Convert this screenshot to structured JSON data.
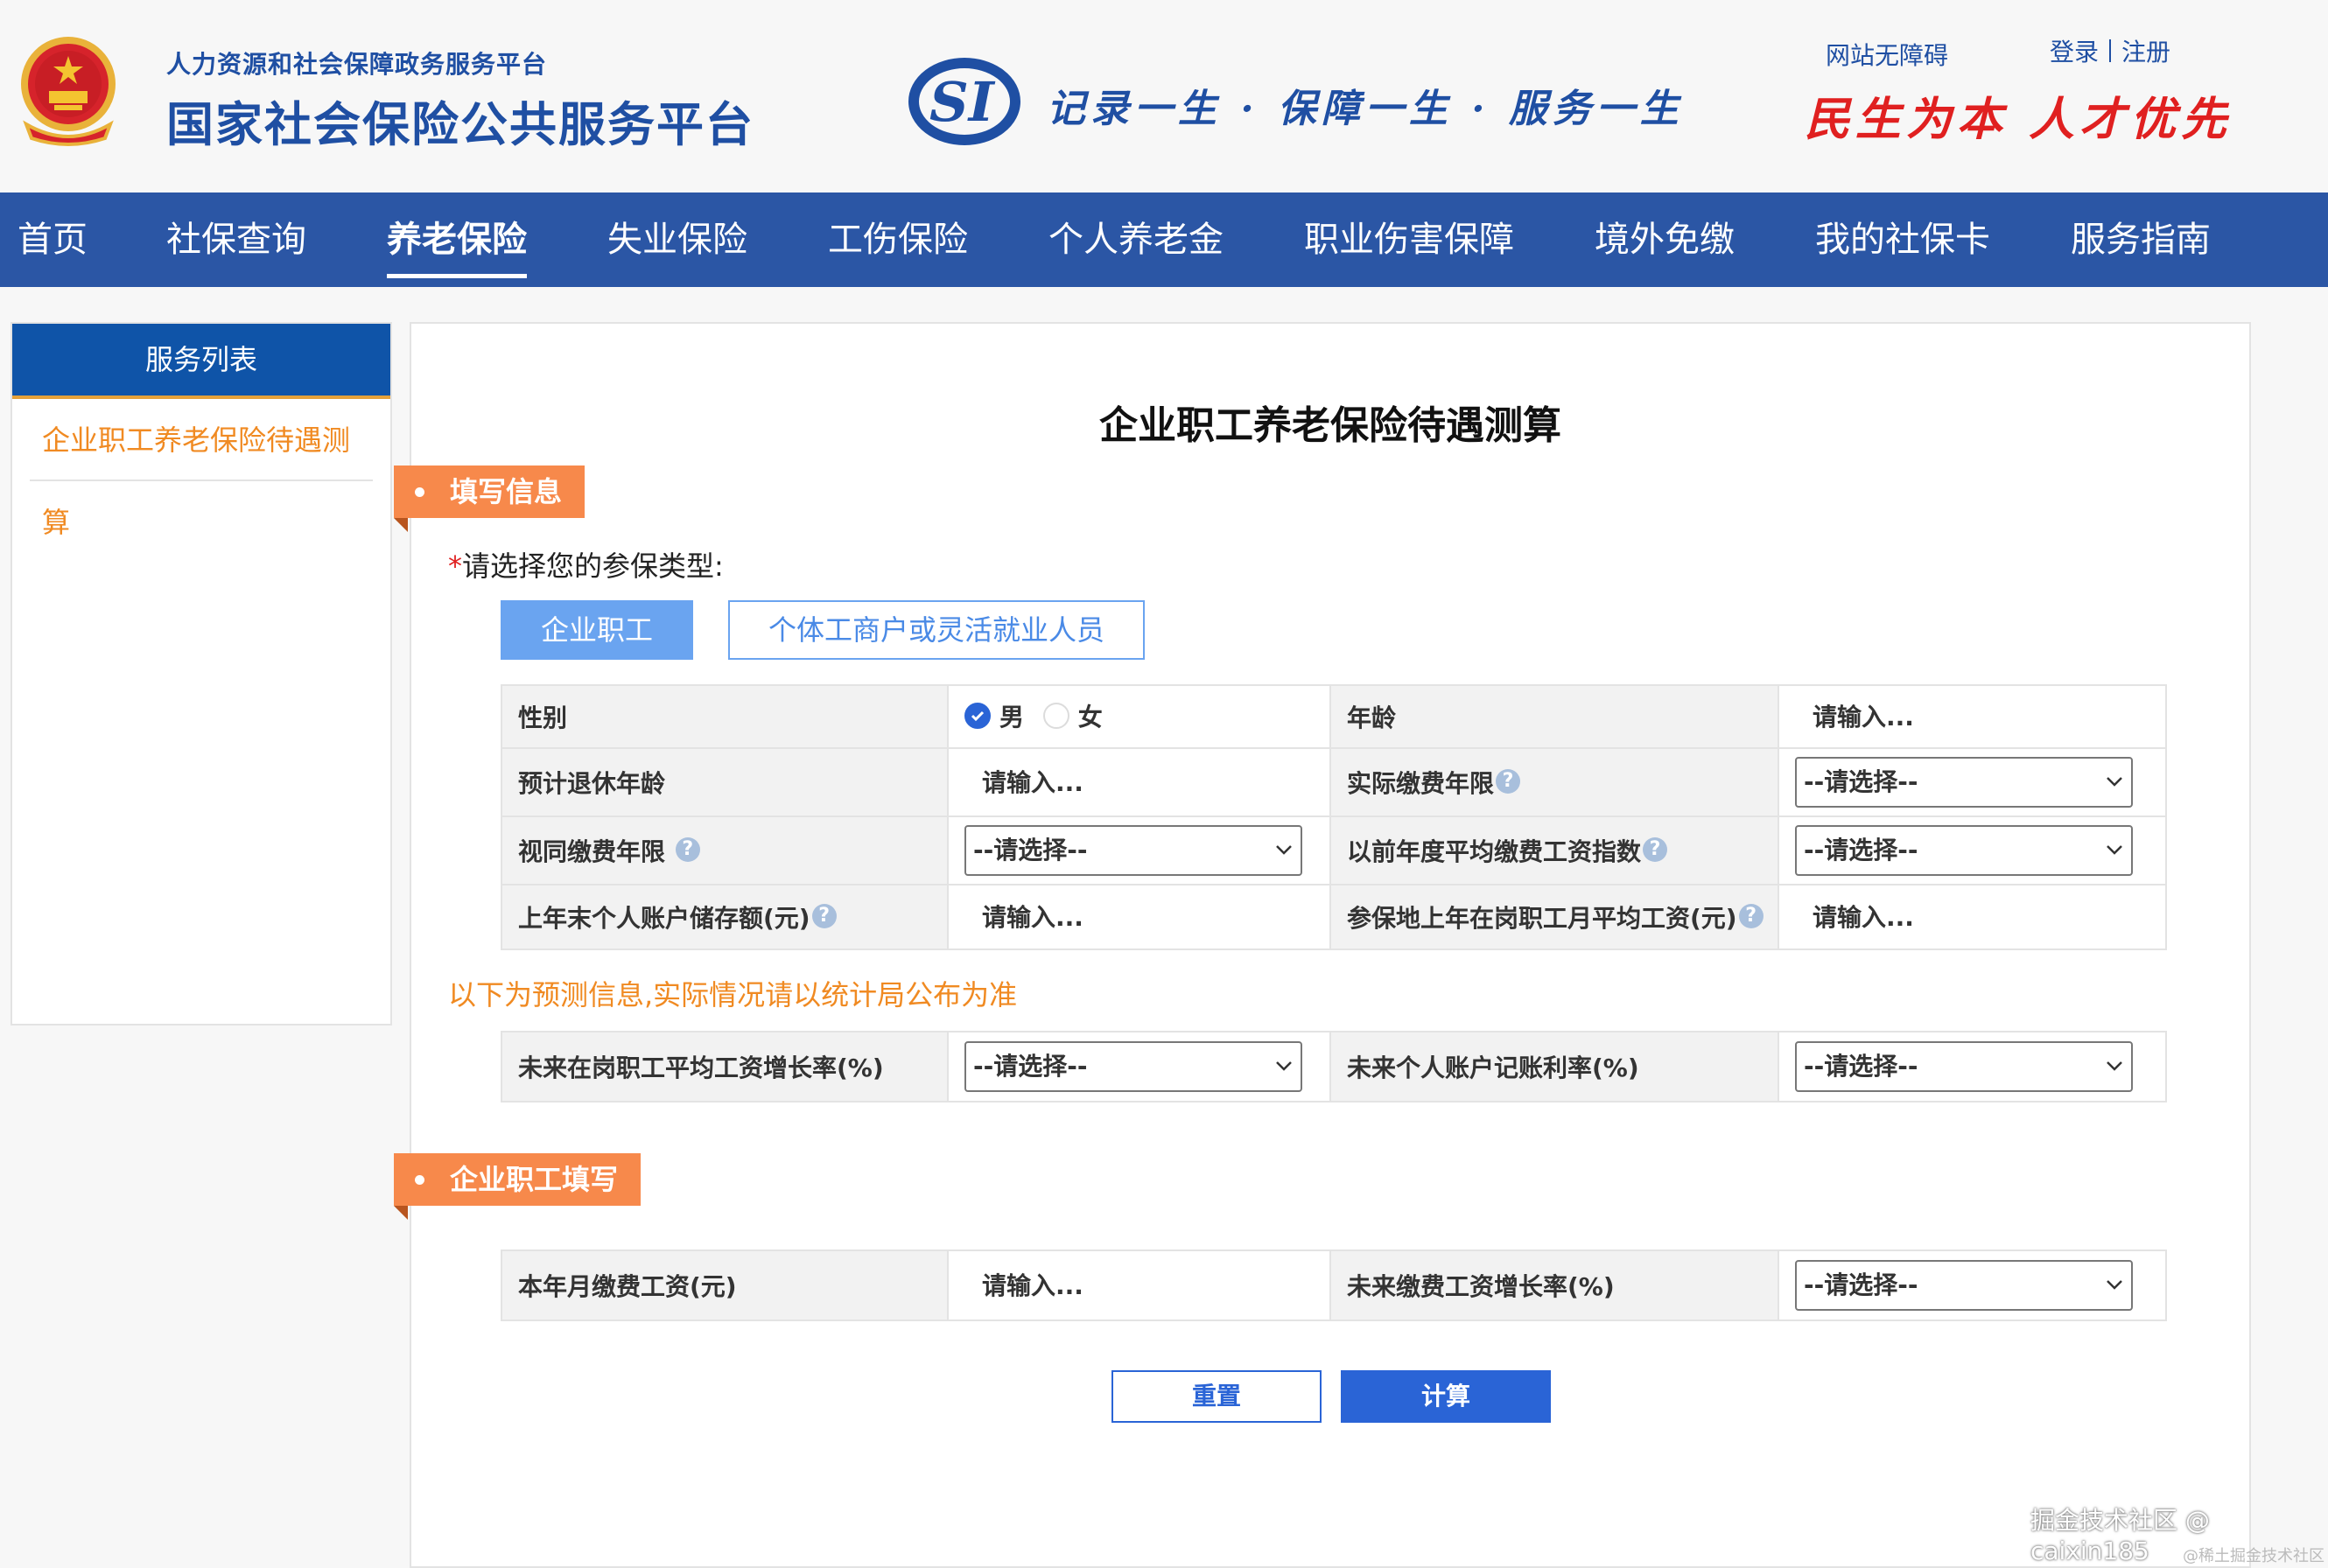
{
  "header": {
    "subtitle": "人力资源和社会保障政务服务平台",
    "title": "国家社会保险公共服务平台",
    "slogan": "记录一生 · 保障一生 · 服务一生",
    "accessibility_link": "网站无障碍",
    "login": "登录",
    "register": "注册",
    "red_slogan": "民生为本 人才优先"
  },
  "nav": {
    "items": [
      "首页",
      "社保查询",
      "养老保险",
      "失业保险",
      "工伤保险",
      "个人养老金",
      "职业伤害保障",
      "境外免缴",
      "我的社保卡",
      "服务指南"
    ],
    "active": "养老保险"
  },
  "sidebar": {
    "heading": "服务列表",
    "item": "企业职工养老保险待遇测算"
  },
  "main": {
    "page_title": "企业职工养老保险待遇测算",
    "section1": "填写信息",
    "insurance_type_label": "请选择您的参保类型:",
    "required_mark": "*",
    "type_employee": "企业职工",
    "type_flex": "个体工商户或灵活就业人员",
    "gender_label": "性别",
    "gender_male": "男",
    "gender_female": "女",
    "age_label": "年龄",
    "input_placeholder": "请输入...",
    "select_placeholder": "--请选择--",
    "retire_age_label": "预计退休年龄",
    "actual_years_label": "实际缴费年限",
    "deemed_years_label": "视同缴费年限",
    "prev_avg_index_label": "以前年度平均缴费工资指数",
    "account_balance_label": "上年末个人账户储存额(元)",
    "local_avg_wage_label": "参保地上年在岗职工月平均工资(元)",
    "help_glyph": "?",
    "forecast_note": "以下为预测信息,实际情况请以统计局公布为准",
    "future_wage_growth_label": "未来在岗职工平均工资增长率(%)",
    "future_account_rate_label": "未来个人账户记账利率(%)",
    "section2": "企业职工填写",
    "monthly_wage_label": "本年月缴费工资(元)",
    "future_pay_growth_label": "未来缴费工资增长率(%)",
    "reset_button": "重置",
    "calc_button": "计算"
  },
  "watermark": {
    "main": "掘金技术社区 @ caixin185",
    "small": "@稀土掘金技术社区"
  }
}
